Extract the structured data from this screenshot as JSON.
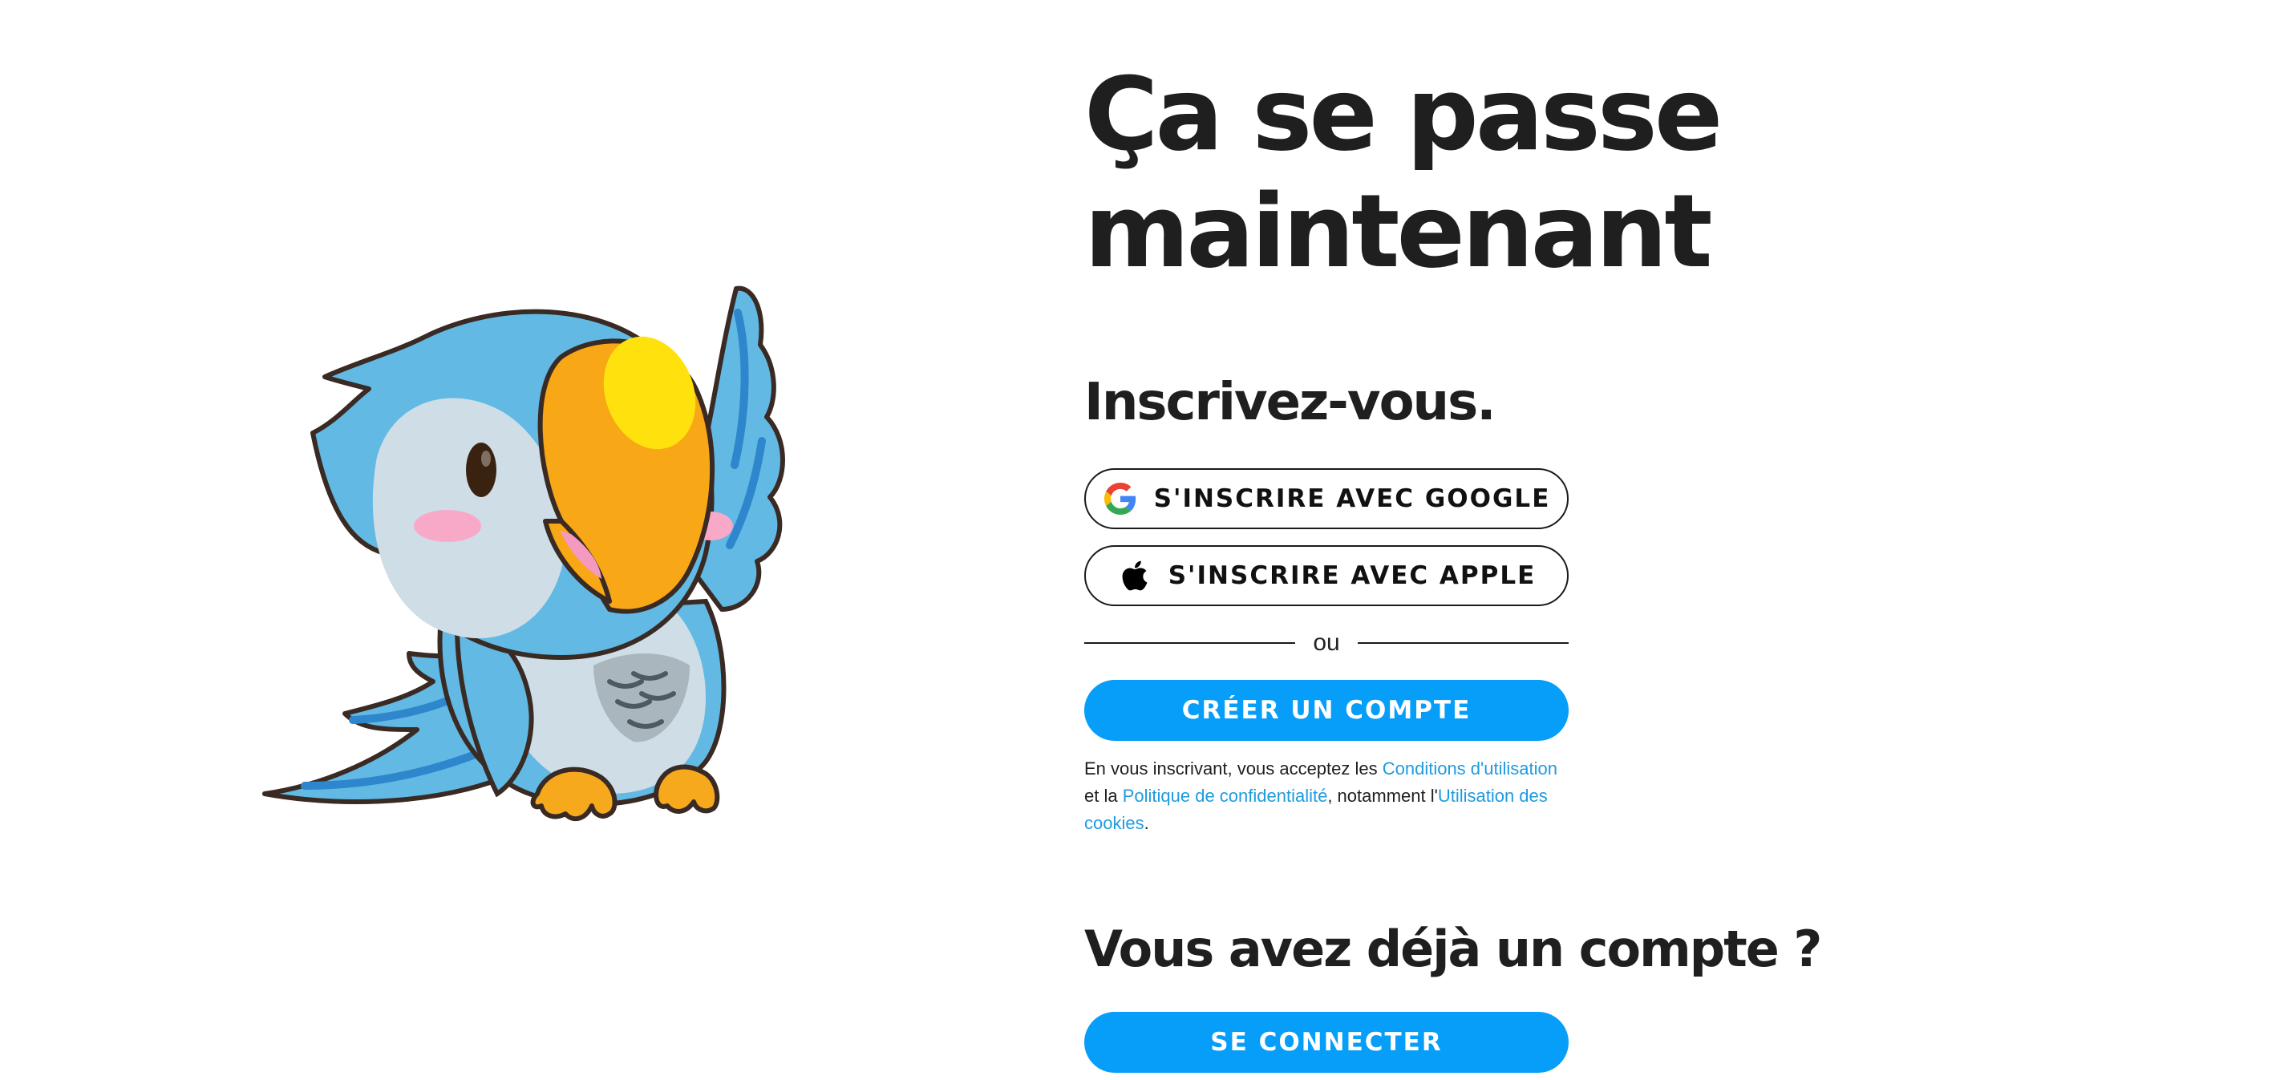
{
  "hero": {
    "line1": "Ça se passe",
    "line2": "maintenant"
  },
  "signup": {
    "title": "Inscrivez-vous.",
    "google_label": "S'INSCRIRE AVEC GOOGLE",
    "apple_label": "S'INSCRIRE AVEC APPLE",
    "divider_text": "ou",
    "create_label": "CRÉER UN COMPTE"
  },
  "legal": {
    "prefix": "En vous inscrivant, vous acceptez les ",
    "terms": "Conditions d'utilisation",
    "and": " et la ",
    "privacy": "Politique de confidentialité",
    "middle": ", notamment l'",
    "cookies": "Utilisation des cookies",
    "suffix": "."
  },
  "login": {
    "title": "Vous avez déjà un compte ?",
    "button_label": "SE CONNECTER"
  },
  "icons": {
    "google": "google-icon",
    "apple": "apple-icon",
    "mascot": "parrot-mascot"
  },
  "colors": {
    "primary": "#069ef8",
    "link": "#1e9be0",
    "text": "#1f1f1f"
  }
}
